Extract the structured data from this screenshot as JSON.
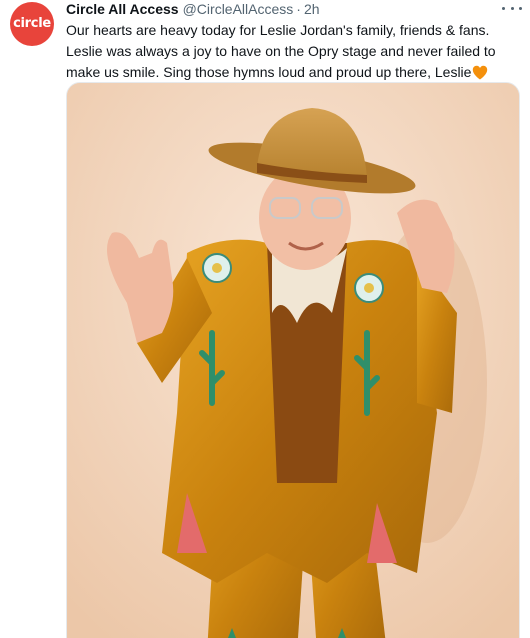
{
  "tweet": {
    "avatar": {
      "label": "circle",
      "color": "#e8443b"
    },
    "display_name": "Circle All Access",
    "handle": "@CircleAllAccess",
    "separator": "·",
    "time": "2h",
    "text": "Our hearts are heavy today for Leslie Jordan's family, friends & fans. Leslie was always a joy to have on the Opry stage and never failed to make us smile. Sing those hymns loud and proud up there, Leslie",
    "emoji": "orange-heart-icon",
    "more_icon": "more-options-icon",
    "media": {
      "type": "photo",
      "description_icon": "photo-image",
      "background_color": "#f2d9c4"
    }
  }
}
